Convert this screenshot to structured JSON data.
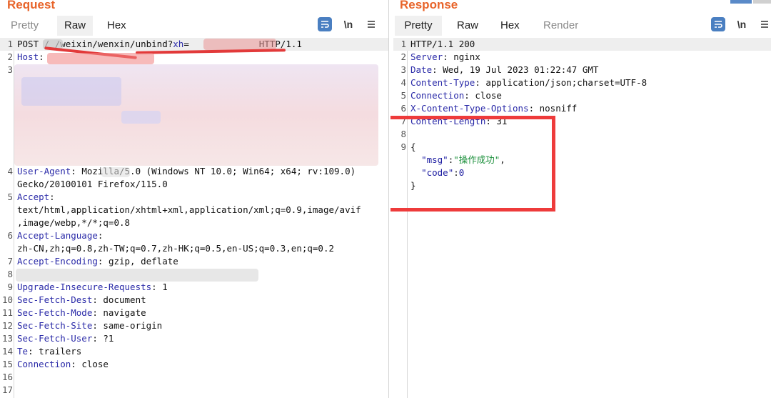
{
  "request": {
    "title": "Request",
    "tabs": [
      "Pretty",
      "Raw",
      "Hex"
    ],
    "active_tab": "Raw",
    "tools": {
      "wrap_icon": "wrap-icon",
      "newline_label": "\\n",
      "menu_icon": "menu-icon"
    },
    "lines": [
      {
        "n": "1",
        "parts": [
          [
            "",
            "POST / "
          ],
          [
            "",
            "/weixin/wenxin/unbind?"
          ],
          [
            "k",
            "xh"
          ],
          [
            "",
            "="
          ],
          [
            "",
            "            "
          ],
          [
            "",
            " HTTP/1.1"
          ]
        ]
      },
      {
        "n": "2",
        "parts": [
          [
            "k",
            "Host"
          ],
          [
            "",
            ":"
          ]
        ]
      },
      {
        "n": "3",
        "parts": []
      },
      {
        "n": "4",
        "parts": [
          [
            "k",
            "User-Agent"
          ],
          [
            "",
            ": Mozilla/5.0 (Windows NT 10.0; Win64; x64; rv:109.0)"
          ]
        ]
      },
      {
        "n": "",
        "parts": [
          [
            "",
            "Gecko/20100101 Firefox/115.0"
          ]
        ]
      },
      {
        "n": "5",
        "parts": [
          [
            "k",
            "Accept"
          ],
          [
            "",
            ":"
          ]
        ]
      },
      {
        "n": "",
        "parts": [
          [
            "",
            "text/html,application/xhtml+xml,application/xml;q=0.9,image/avif"
          ]
        ]
      },
      {
        "n": "",
        "parts": [
          [
            "",
            ",image/webp,*/*;q=0.8"
          ]
        ]
      },
      {
        "n": "6",
        "parts": [
          [
            "k",
            "Accept-Language"
          ],
          [
            "",
            ":"
          ]
        ]
      },
      {
        "n": "",
        "parts": [
          [
            "",
            "zh-CN,zh;q=0.8,zh-TW;q=0.7,zh-HK;q=0.5,en-US;q=0.3,en;q=0.2"
          ]
        ]
      },
      {
        "n": "7",
        "parts": [
          [
            "k",
            "Accept-Encoding"
          ],
          [
            "",
            ": gzip, deflate"
          ]
        ]
      },
      {
        "n": "8",
        "parts": []
      },
      {
        "n": "9",
        "parts": [
          [
            "k",
            "Upgrade-Insecure-Requests"
          ],
          [
            "",
            ": 1"
          ]
        ]
      },
      {
        "n": "10",
        "parts": [
          [
            "k",
            "Sec-Fetch-Dest"
          ],
          [
            "",
            ": document"
          ]
        ]
      },
      {
        "n": "11",
        "parts": [
          [
            "k",
            "Sec-Fetch-Mode"
          ],
          [
            "",
            ": navigate"
          ]
        ]
      },
      {
        "n": "12",
        "parts": [
          [
            "k",
            "Sec-Fetch-Site"
          ],
          [
            "",
            ": same-origin"
          ]
        ]
      },
      {
        "n": "13",
        "parts": [
          [
            "k",
            "Sec-Fetch-User"
          ],
          [
            "",
            ": ?1"
          ]
        ]
      },
      {
        "n": "14",
        "parts": [
          [
            "k",
            "Te"
          ],
          [
            "",
            ": trailers"
          ]
        ]
      },
      {
        "n": "15",
        "parts": [
          [
            "k",
            "Connection"
          ],
          [
            "",
            ": close"
          ]
        ]
      },
      {
        "n": "16",
        "parts": []
      },
      {
        "n": "17",
        "parts": []
      }
    ]
  },
  "response": {
    "title": "Response",
    "tabs": [
      "Pretty",
      "Raw",
      "Hex",
      "Render"
    ],
    "active_tab": "Pretty",
    "tools": {
      "wrap_icon": "wrap-icon",
      "newline_label": "\\n",
      "menu_icon": "menu-icon"
    },
    "lines": [
      {
        "n": "1",
        "parts": [
          [
            "",
            "HTTP/1.1 200"
          ]
        ]
      },
      {
        "n": "2",
        "parts": [
          [
            "k",
            "Server"
          ],
          [
            "",
            ": nginx"
          ]
        ]
      },
      {
        "n": "3",
        "parts": [
          [
            "k",
            "Date"
          ],
          [
            "",
            ": Wed, 19 Jul 2023 01:22:47 GMT"
          ]
        ]
      },
      {
        "n": "4",
        "parts": [
          [
            "k",
            "Content-Type"
          ],
          [
            "",
            ": application/json;charset=UTF-8"
          ]
        ]
      },
      {
        "n": "5",
        "parts": [
          [
            "k",
            "Connection"
          ],
          [
            "",
            ": close"
          ]
        ]
      },
      {
        "n": "6",
        "parts": [
          [
            "k",
            "X-Content-Type-Options"
          ],
          [
            "",
            ": nosniff"
          ]
        ]
      },
      {
        "n": "7",
        "parts": [
          [
            "k",
            "Content-Length"
          ],
          [
            "",
            ": 31"
          ]
        ]
      },
      {
        "n": "8",
        "parts": []
      },
      {
        "n": "9",
        "parts": [
          [
            "",
            "{"
          ]
        ]
      },
      {
        "n": "",
        "parts": [
          [
            "",
            "  "
          ],
          [
            "mk",
            "\"msg\""
          ],
          [
            "",
            ":"
          ],
          [
            "v",
            "\"操作成功\""
          ],
          [
            "",
            ","
          ]
        ]
      },
      {
        "n": "",
        "parts": [
          [
            "",
            "  "
          ],
          [
            "mk",
            "\"code\""
          ],
          [
            "",
            ":"
          ],
          [
            "mk",
            "0"
          ]
        ]
      },
      {
        "n": "",
        "parts": [
          [
            "",
            "}"
          ]
        ]
      }
    ]
  },
  "colors": {
    "accent_orange": "#e8642a",
    "header_key": "#2a2aa8",
    "json_value": "#1a8f3a",
    "annotation_red": "#ee3b3b",
    "wrap_button_blue": "#4a7fc1"
  }
}
